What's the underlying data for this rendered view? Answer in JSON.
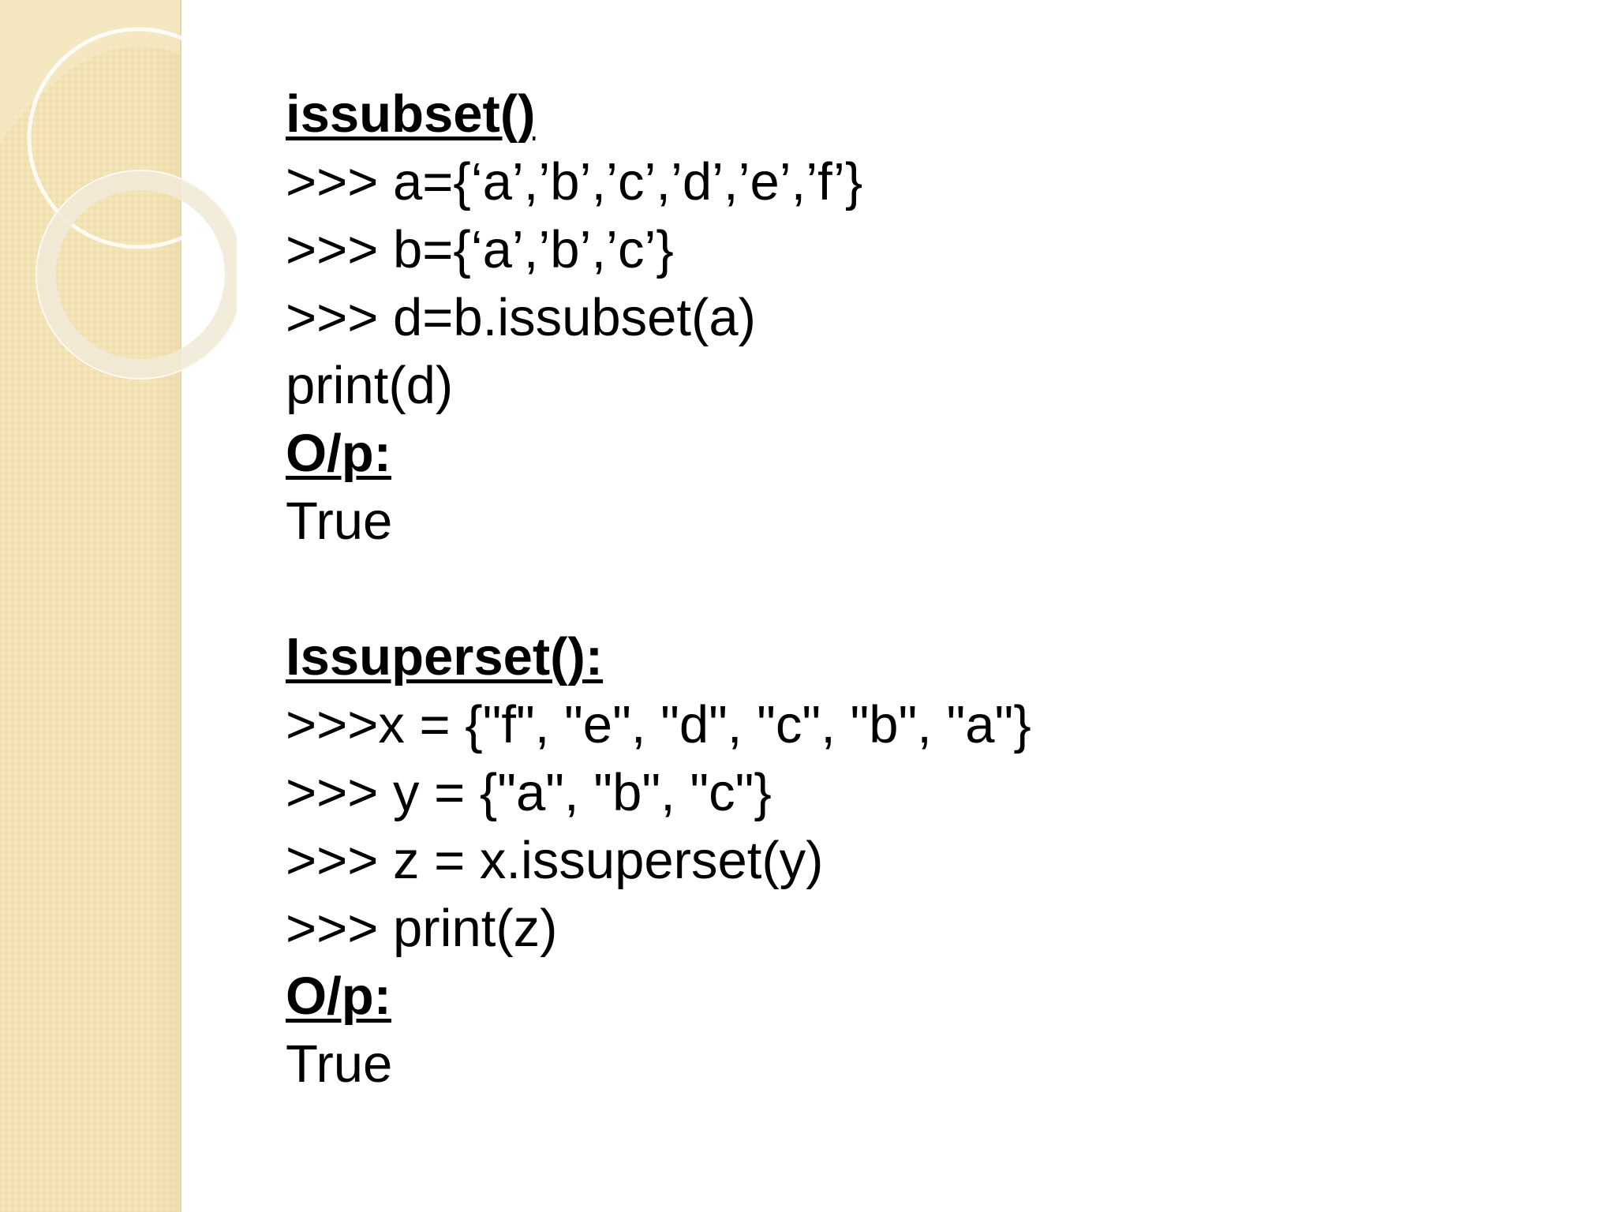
{
  "slide": {
    "sections": [
      {
        "heading": "issubset()",
        "code": [
          ">>> a={‘a’,’b’,’c’,’d’,’e’,’f’}",
          ">>> b={‘a’,’b’,’c’}",
          ">>> d=b.issubset(a)",
          "print(d)"
        ],
        "output_label": "O/p:",
        "output": "True"
      },
      {
        "heading": "Issuperset():",
        "code": [
          ">>>x = {\"f\", \"e\", \"d\", \"c\", \"b\", \"a\"}",
          ">>> y = {\"a\", \"b\", \"c\"}",
          ">>> z = x.issuperset(y)",
          ">>> print(z)"
        ],
        "output_label": "O/p:",
        "output": "True"
      }
    ]
  },
  "theme": {
    "band_color": "#f3e2b3",
    "ring_color": "#ffffff",
    "text_color": "#000000"
  }
}
